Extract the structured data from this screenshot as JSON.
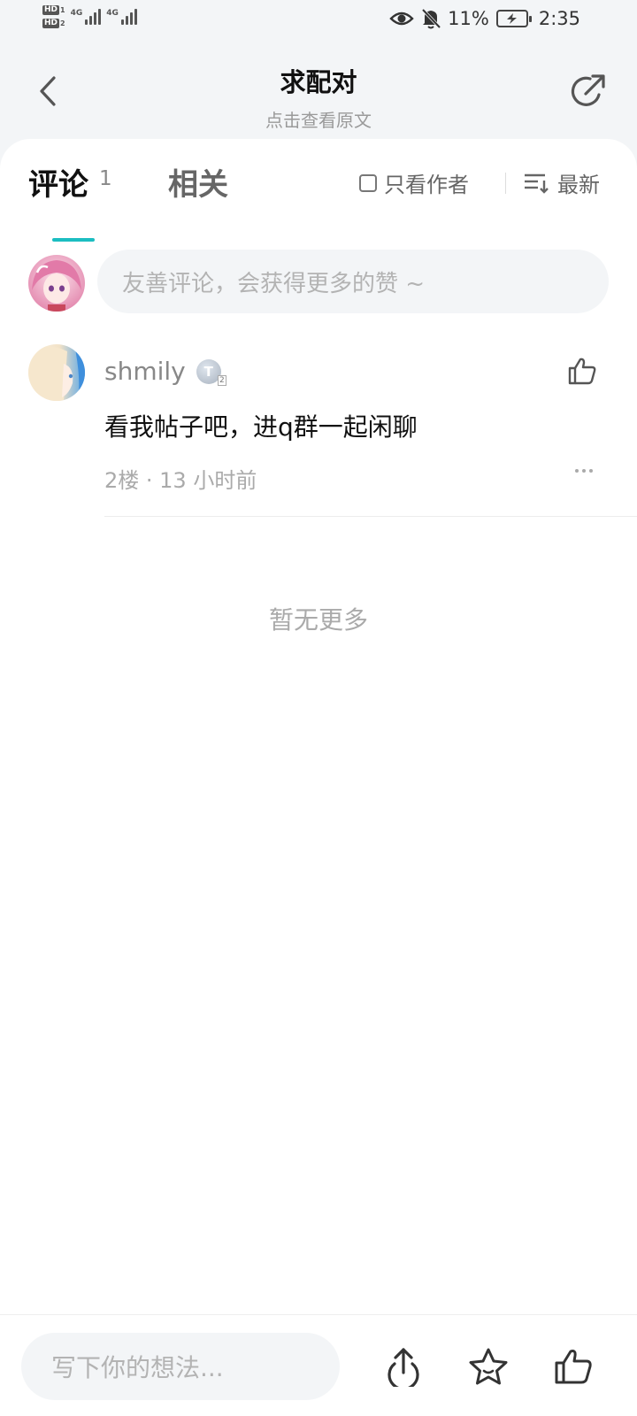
{
  "status_bar": {
    "hd1_num": "1",
    "hd2_num": "2",
    "network1": "4G",
    "network2": "4G",
    "battery_percent": "11%",
    "time": "2:35"
  },
  "header": {
    "title": "求配对",
    "subtitle": "点击查看原文"
  },
  "tabs": {
    "comments_label": "评论",
    "comments_count": "1",
    "related_label": "相关",
    "author_only_label": "只看作者",
    "sort_label": "最新",
    "accent_color": "#1bbdc1"
  },
  "composer": {
    "placeholder": "友善评论，会获得更多的赞 ~"
  },
  "comments": [
    {
      "username": "shmily",
      "badge_letter": "T",
      "badge_level": "2",
      "text": "看我帖子吧，进q群一起闲聊",
      "meta": "2楼 · 13 小时前"
    }
  ],
  "list_end_text": "暂无更多",
  "bottom_bar": {
    "input_placeholder": "写下你的想法..."
  },
  "icons": [
    "back-icon",
    "share-external-icon",
    "eye-icon",
    "bell-off-icon",
    "battery-charging-icon",
    "sort-icon",
    "thumb-up-icon",
    "more-icon",
    "upload-share-icon",
    "star-icon"
  ]
}
